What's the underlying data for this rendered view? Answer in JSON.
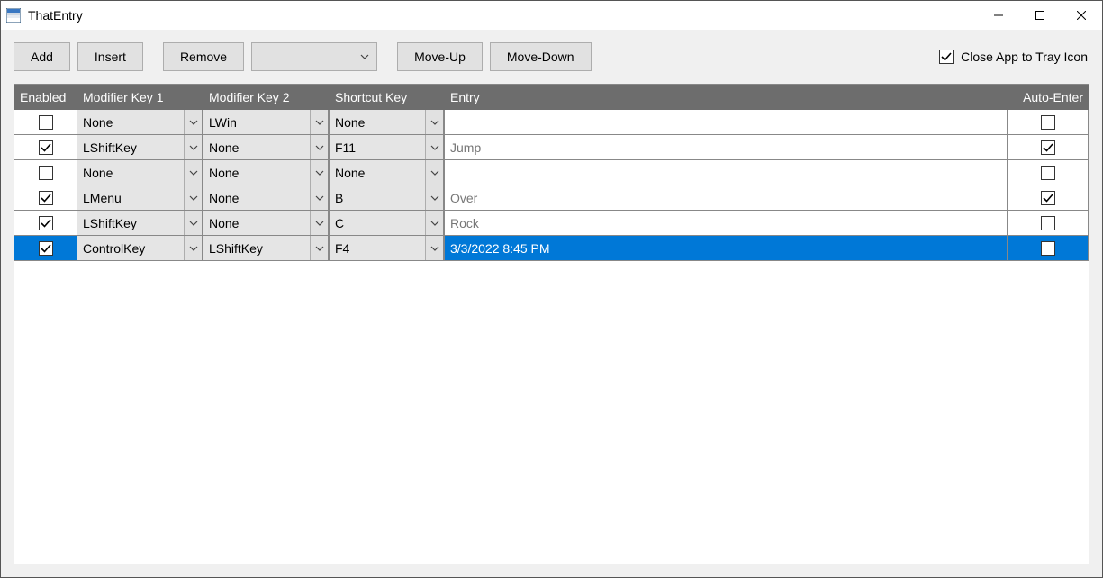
{
  "window": {
    "title": "ThatEntry"
  },
  "toolbar": {
    "add": "Add",
    "insert": "Insert",
    "remove": "Remove",
    "filter_selected": "",
    "moveup": "Move-Up",
    "movedown": "Move-Down",
    "close_to_tray_label": "Close App to Tray Icon",
    "close_to_tray_checked": true
  },
  "grid": {
    "headers": {
      "enabled": "Enabled",
      "mod1": "Modifier Key 1",
      "mod2": "Modifier Key 2",
      "shortcut": "Shortcut Key",
      "entry": "Entry",
      "autoenter": "Auto-Enter"
    },
    "rows": [
      {
        "enabled": false,
        "mod1": "None",
        "mod2": "LWin",
        "shortcut": "None",
        "entry": "",
        "autoenter": false,
        "selected": false
      },
      {
        "enabled": true,
        "mod1": "LShiftKey",
        "mod2": "None",
        "shortcut": "F11",
        "entry": "Jump",
        "autoenter": true,
        "selected": false
      },
      {
        "enabled": false,
        "mod1": "None",
        "mod2": "None",
        "shortcut": "None",
        "entry": "",
        "autoenter": false,
        "selected": false
      },
      {
        "enabled": true,
        "mod1": "LMenu",
        "mod2": "None",
        "shortcut": "B",
        "entry": "Over",
        "autoenter": true,
        "selected": false
      },
      {
        "enabled": true,
        "mod1": "LShiftKey",
        "mod2": "None",
        "shortcut": "C",
        "entry": "Rock",
        "autoenter": false,
        "selected": false
      },
      {
        "enabled": true,
        "mod1": "ControlKey",
        "mod2": "LShiftKey",
        "shortcut": "F4",
        "entry": "3/3/2022 8:45 PM",
        "autoenter": false,
        "selected": true
      }
    ]
  }
}
